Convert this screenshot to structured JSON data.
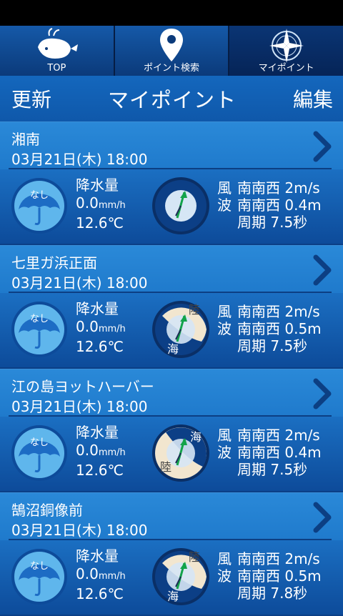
{
  "nav": {
    "top_label": "TOP",
    "search_label": "ポイント検索",
    "mypoint_label": "マイポイント"
  },
  "titlebar": {
    "refresh": "更新",
    "title": "マイポイント",
    "edit": "編集"
  },
  "points": [
    {
      "name": "湘南",
      "datetime": "03月21日(木) 18:00",
      "weather_badge": "なし",
      "precip_label": "降水量",
      "precip_value": "0.0",
      "precip_unit": "mm/h",
      "temp": "12.6℃",
      "compass_labels": [],
      "wind_label": "風",
      "wind": "南南西 2m/s",
      "wave_label": "波",
      "wave": "南南西 0.4m",
      "period": "周期 7.5秒"
    },
    {
      "name": "七里ガ浜正面",
      "datetime": "03月21日(木) 18:00",
      "weather_badge": "なし",
      "precip_label": "降水量",
      "precip_value": "0.0",
      "precip_unit": "mm/h",
      "temp": "12.6℃",
      "compass_labels": [
        "陸",
        "海"
      ],
      "wind_label": "風",
      "wind": "南南西 2m/s",
      "wave_label": "波",
      "wave": "南南西 0.5m",
      "period": "周期 7.5秒"
    },
    {
      "name": "江の島ヨットハーバー",
      "datetime": "03月21日(木) 18:00",
      "weather_badge": "なし",
      "precip_label": "降水量",
      "precip_value": "0.0",
      "precip_unit": "mm/h",
      "temp": "12.6℃",
      "compass_labels": [
        "海",
        "陸"
      ],
      "wind_label": "風",
      "wind": "南南西 2m/s",
      "wave_label": "波",
      "wave": "南南西 0.4m",
      "period": "周期 7.5秒"
    },
    {
      "name": "鵠沼銅像前",
      "datetime": "03月21日(木) 18:00",
      "weather_badge": "なし",
      "precip_label": "降水量",
      "precip_value": "0.0",
      "precip_unit": "mm/h",
      "temp": "12.6℃",
      "compass_labels": [
        "陸",
        "海"
      ],
      "wind_label": "風",
      "wind": "南南西 2m/s",
      "wave_label": "波",
      "wave": "南南西 0.5m",
      "period": "周期 7.8秒"
    }
  ],
  "colors": {
    "land": "#f2e6cf",
    "sea": "#0c3f86",
    "arrow": "#13a34a"
  }
}
